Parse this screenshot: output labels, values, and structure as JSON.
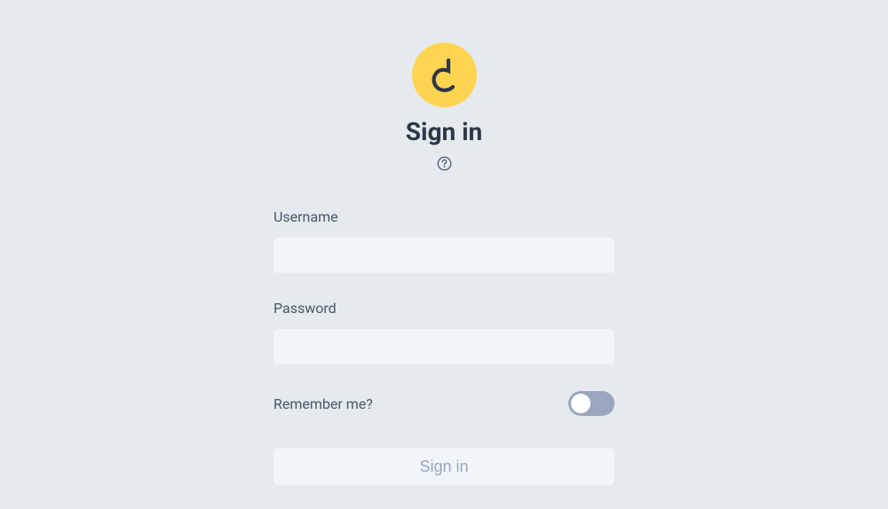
{
  "heading": "Sign in",
  "fields": {
    "username": {
      "label": "Username",
      "value": ""
    },
    "password": {
      "label": "Password",
      "value": ""
    }
  },
  "remember": {
    "label": "Remember me?",
    "checked": false
  },
  "submit": {
    "label": "Sign in"
  }
}
